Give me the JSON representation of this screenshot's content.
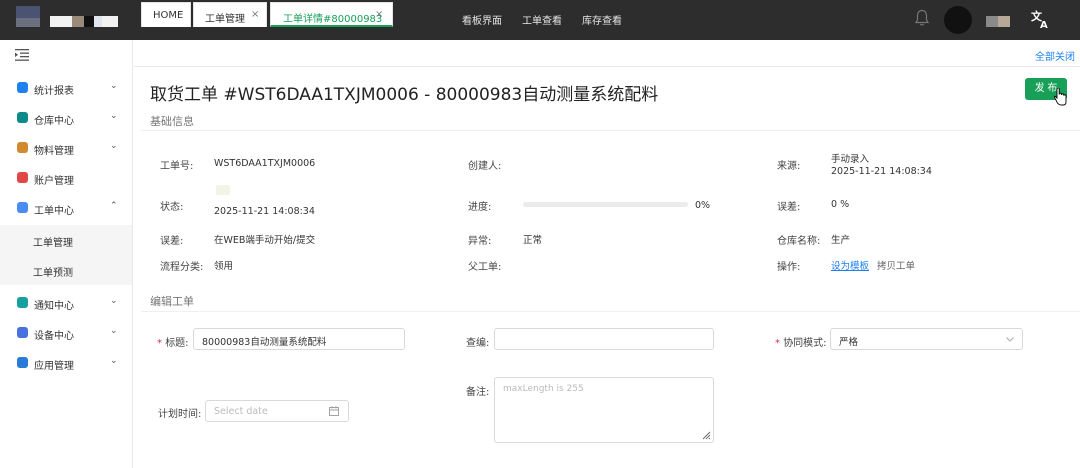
{
  "topnav": {
    "items": [
      "看板界面",
      "工单查看",
      "库存查看"
    ]
  },
  "sidebar": {
    "items": [
      {
        "label": "统计报表",
        "arrow": "⌄",
        "icon": "chart-icon",
        "color": "#2080f0"
      },
      {
        "label": "仓库中心",
        "arrow": "⌄",
        "icon": "warehouse-icon",
        "color": "#0e8a8a"
      },
      {
        "label": "物料管理",
        "arrow": "⌄",
        "icon": "material-icon",
        "color": "#d08a30"
      },
      {
        "label": "账户管理",
        "arrow": "",
        "icon": "account-icon",
        "color": "#e04848"
      },
      {
        "label": "工单中心",
        "arrow": "⌃",
        "icon": "workorder-icon",
        "color": "#4a8cf0"
      },
      {
        "label": "通知中心",
        "arrow": "⌄",
        "icon": "notice-icon",
        "color": "#18a0a0"
      },
      {
        "label": "设备中心",
        "arrow": "⌄",
        "icon": "device-icon",
        "color": "#4a70e0"
      },
      {
        "label": "应用管理",
        "arrow": "⌄",
        "icon": "app-icon",
        "color": "#2a7ad8"
      }
    ],
    "sub_items": [
      "工单管理",
      "工单预测"
    ]
  },
  "tabs": [
    {
      "label": "HOME"
    },
    {
      "label": "工单管理",
      "close": "×"
    },
    {
      "label": "工单详情#80000983",
      "close": "×"
    }
  ],
  "close_all": "全部关闭",
  "page": {
    "title": "取货工单 #WST6DAA1TXJM0006 - 80000983自动测量系统配料",
    "publish": "发 布"
  },
  "basic": {
    "section": "基础信息",
    "order_no_label": "工单号:",
    "order_no": "WST6DAA1TXJM0006",
    "creator_label": "创建人:",
    "source_label": "来源:",
    "source": "手动录入",
    "source_time": "2025-11-21 14:08:34",
    "status_label": "状态:",
    "status_time": "2025-11-21 14:08:34",
    "progress_label": "进度:",
    "progress": 0,
    "progress_text": "0%",
    "error_label": "误差:",
    "error": "0 %",
    "error2_label": "误差:",
    "error2": "在WEB端手动开始/提交",
    "abnormal_label": "异常:",
    "abnormal": "正常",
    "warehouse_label": "仓库名称:",
    "warehouse": "生产",
    "flow_label": "流程分类:",
    "flow": "领用",
    "parent_label": "父工单:",
    "ops_label": "操作:",
    "op_template": "设为模板",
    "op_copy": "拷贝工单"
  },
  "edit": {
    "section": "编辑工单",
    "title_label": "标题:",
    "title_value": "80000983自动测量系统配料",
    "reviewer_label": "查编:",
    "mode_label": "协同模式:",
    "mode_value": "严格",
    "remark_label": "备注:",
    "remark_placeholder": "maxLength is 255",
    "plan_label": "计划时间:",
    "plan_placeholder": "Select date"
  }
}
